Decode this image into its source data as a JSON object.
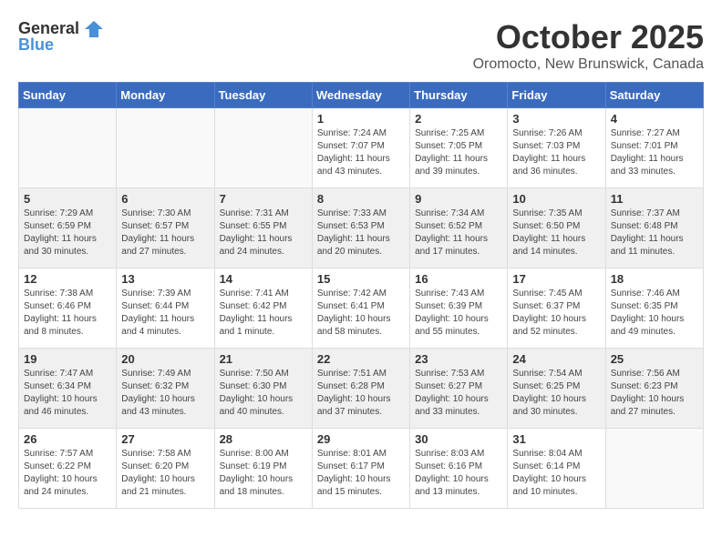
{
  "logo": {
    "general": "General",
    "blue": "Blue"
  },
  "title": "October 2025",
  "subtitle": "Oromocto, New Brunswick, Canada",
  "days_of_week": [
    "Sunday",
    "Monday",
    "Tuesday",
    "Wednesday",
    "Thursday",
    "Friday",
    "Saturday"
  ],
  "weeks": [
    {
      "shaded": false,
      "days": [
        {
          "num": "",
          "info": ""
        },
        {
          "num": "",
          "info": ""
        },
        {
          "num": "",
          "info": ""
        },
        {
          "num": "1",
          "info": "Sunrise: 7:24 AM\nSunset: 7:07 PM\nDaylight: 11 hours\nand 43 minutes."
        },
        {
          "num": "2",
          "info": "Sunrise: 7:25 AM\nSunset: 7:05 PM\nDaylight: 11 hours\nand 39 minutes."
        },
        {
          "num": "3",
          "info": "Sunrise: 7:26 AM\nSunset: 7:03 PM\nDaylight: 11 hours\nand 36 minutes."
        },
        {
          "num": "4",
          "info": "Sunrise: 7:27 AM\nSunset: 7:01 PM\nDaylight: 11 hours\nand 33 minutes."
        }
      ]
    },
    {
      "shaded": true,
      "days": [
        {
          "num": "5",
          "info": "Sunrise: 7:29 AM\nSunset: 6:59 PM\nDaylight: 11 hours\nand 30 minutes."
        },
        {
          "num": "6",
          "info": "Sunrise: 7:30 AM\nSunset: 6:57 PM\nDaylight: 11 hours\nand 27 minutes."
        },
        {
          "num": "7",
          "info": "Sunrise: 7:31 AM\nSunset: 6:55 PM\nDaylight: 11 hours\nand 24 minutes."
        },
        {
          "num": "8",
          "info": "Sunrise: 7:33 AM\nSunset: 6:53 PM\nDaylight: 11 hours\nand 20 minutes."
        },
        {
          "num": "9",
          "info": "Sunrise: 7:34 AM\nSunset: 6:52 PM\nDaylight: 11 hours\nand 17 minutes."
        },
        {
          "num": "10",
          "info": "Sunrise: 7:35 AM\nSunset: 6:50 PM\nDaylight: 11 hours\nand 14 minutes."
        },
        {
          "num": "11",
          "info": "Sunrise: 7:37 AM\nSunset: 6:48 PM\nDaylight: 11 hours\nand 11 minutes."
        }
      ]
    },
    {
      "shaded": false,
      "days": [
        {
          "num": "12",
          "info": "Sunrise: 7:38 AM\nSunset: 6:46 PM\nDaylight: 11 hours\nand 8 minutes."
        },
        {
          "num": "13",
          "info": "Sunrise: 7:39 AM\nSunset: 6:44 PM\nDaylight: 11 hours\nand 4 minutes."
        },
        {
          "num": "14",
          "info": "Sunrise: 7:41 AM\nSunset: 6:42 PM\nDaylight: 11 hours\nand 1 minute."
        },
        {
          "num": "15",
          "info": "Sunrise: 7:42 AM\nSunset: 6:41 PM\nDaylight: 10 hours\nand 58 minutes."
        },
        {
          "num": "16",
          "info": "Sunrise: 7:43 AM\nSunset: 6:39 PM\nDaylight: 10 hours\nand 55 minutes."
        },
        {
          "num": "17",
          "info": "Sunrise: 7:45 AM\nSunset: 6:37 PM\nDaylight: 10 hours\nand 52 minutes."
        },
        {
          "num": "18",
          "info": "Sunrise: 7:46 AM\nSunset: 6:35 PM\nDaylight: 10 hours\nand 49 minutes."
        }
      ]
    },
    {
      "shaded": true,
      "days": [
        {
          "num": "19",
          "info": "Sunrise: 7:47 AM\nSunset: 6:34 PM\nDaylight: 10 hours\nand 46 minutes."
        },
        {
          "num": "20",
          "info": "Sunrise: 7:49 AM\nSunset: 6:32 PM\nDaylight: 10 hours\nand 43 minutes."
        },
        {
          "num": "21",
          "info": "Sunrise: 7:50 AM\nSunset: 6:30 PM\nDaylight: 10 hours\nand 40 minutes."
        },
        {
          "num": "22",
          "info": "Sunrise: 7:51 AM\nSunset: 6:28 PM\nDaylight: 10 hours\nand 37 minutes."
        },
        {
          "num": "23",
          "info": "Sunrise: 7:53 AM\nSunset: 6:27 PM\nDaylight: 10 hours\nand 33 minutes."
        },
        {
          "num": "24",
          "info": "Sunrise: 7:54 AM\nSunset: 6:25 PM\nDaylight: 10 hours\nand 30 minutes."
        },
        {
          "num": "25",
          "info": "Sunrise: 7:56 AM\nSunset: 6:23 PM\nDaylight: 10 hours\nand 27 minutes."
        }
      ]
    },
    {
      "shaded": false,
      "days": [
        {
          "num": "26",
          "info": "Sunrise: 7:57 AM\nSunset: 6:22 PM\nDaylight: 10 hours\nand 24 minutes."
        },
        {
          "num": "27",
          "info": "Sunrise: 7:58 AM\nSunset: 6:20 PM\nDaylight: 10 hours\nand 21 minutes."
        },
        {
          "num": "28",
          "info": "Sunrise: 8:00 AM\nSunset: 6:19 PM\nDaylight: 10 hours\nand 18 minutes."
        },
        {
          "num": "29",
          "info": "Sunrise: 8:01 AM\nSunset: 6:17 PM\nDaylight: 10 hours\nand 15 minutes."
        },
        {
          "num": "30",
          "info": "Sunrise: 8:03 AM\nSunset: 6:16 PM\nDaylight: 10 hours\nand 13 minutes."
        },
        {
          "num": "31",
          "info": "Sunrise: 8:04 AM\nSunset: 6:14 PM\nDaylight: 10 hours\nand 10 minutes."
        },
        {
          "num": "",
          "info": ""
        }
      ]
    }
  ]
}
